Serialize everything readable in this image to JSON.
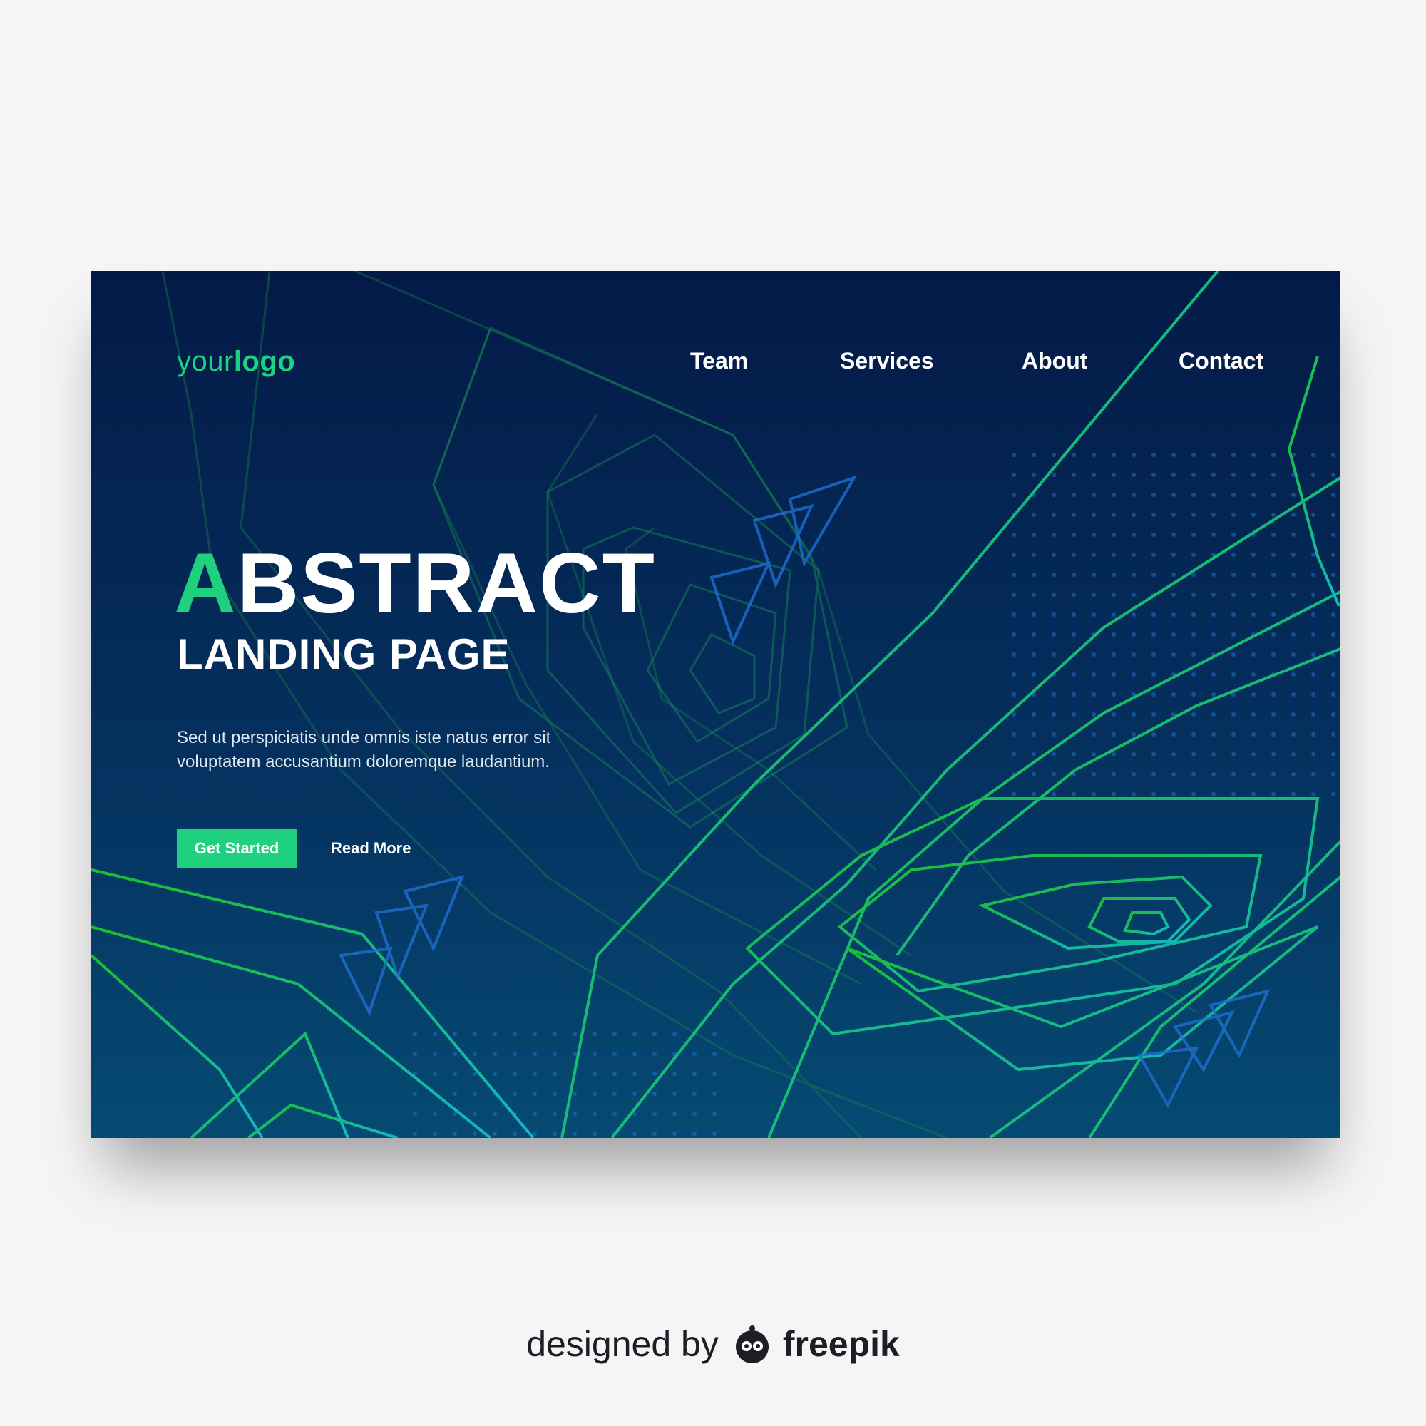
{
  "logo": {
    "prefix": "your",
    "bold": "logo"
  },
  "nav": {
    "items": [
      {
        "label": "Team"
      },
      {
        "label": "Services"
      },
      {
        "label": "About"
      },
      {
        "label": "Contact"
      }
    ]
  },
  "hero": {
    "title_accent": "A",
    "title_rest": "BSTRACT",
    "subtitle": "LANDING PAGE",
    "description": "Sed ut perspiciatis unde omnis iste natus error sit voluptatem accusantium doloremque laudantium.",
    "primary_button": "Get Started",
    "secondary_button": "Read More"
  },
  "credit": {
    "prefix": "designed by",
    "brand": "freepik"
  },
  "colors": {
    "background": "#f5f5f5",
    "card_top": "#031a47",
    "card_bottom": "#054a72",
    "accent_green": "#1fd07f",
    "line_green": "#16c23a",
    "line_cyan": "#10b0c8",
    "dot_blue": "#1e6fd0"
  }
}
